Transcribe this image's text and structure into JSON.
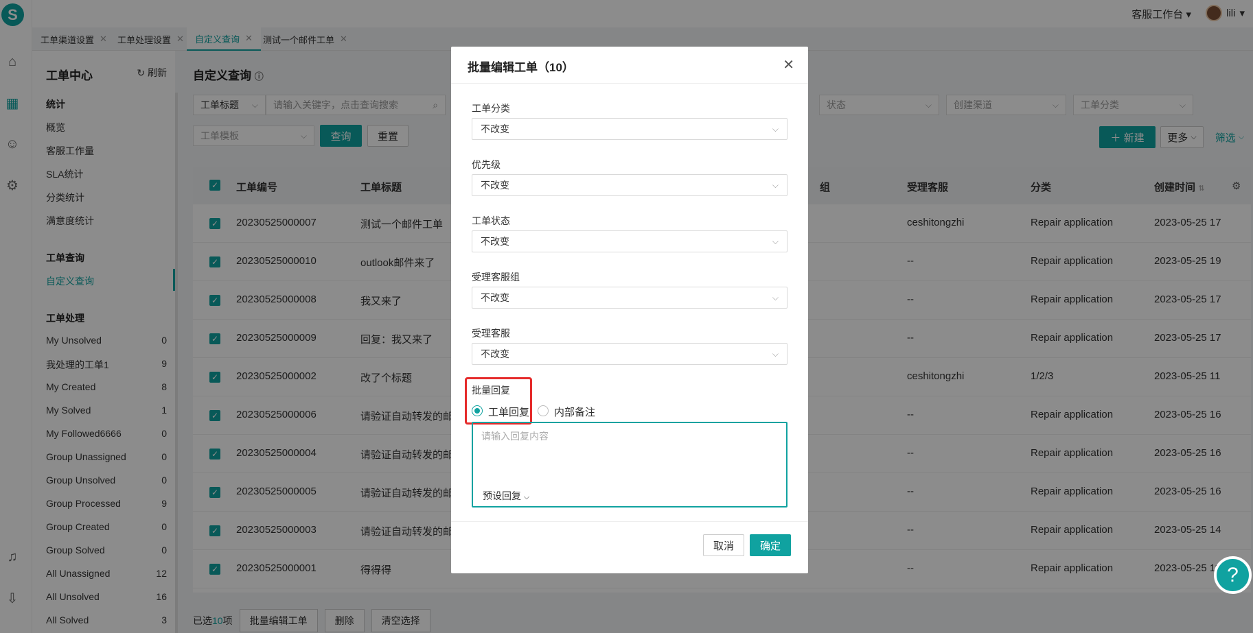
{
  "logo": "S",
  "topbar": {
    "workspace": "客服工作台",
    "username": "lili"
  },
  "tabs": [
    {
      "label": "工单渠道设置"
    },
    {
      "label": "工单处理设置"
    },
    {
      "label": "自定义查询"
    },
    {
      "label": "测试一个邮件工单"
    }
  ],
  "sidebar": {
    "title": "工单中心",
    "refresh": "刷新",
    "stats_header": "统计",
    "stats": [
      "概览",
      "客服工作量",
      "SLA统计",
      "分类统计",
      "满意度统计"
    ],
    "query_header": "工单查询",
    "query_item": "自定义查询",
    "process_header": "工单处理",
    "process": [
      {
        "label": "My Unsolved",
        "count": "0"
      },
      {
        "label": "我处理的工单1",
        "count": "9"
      },
      {
        "label": "My Created",
        "count": "8"
      },
      {
        "label": "My Solved",
        "count": "1"
      },
      {
        "label": "My Followed6666",
        "count": "0"
      },
      {
        "label": "Group Unassigned",
        "count": "0"
      },
      {
        "label": "Group Unsolved",
        "count": "0"
      },
      {
        "label": "Group Processed",
        "count": "9"
      },
      {
        "label": "Group Created",
        "count": "0"
      },
      {
        "label": "Group Solved",
        "count": "0"
      },
      {
        "label": "All Unassigned",
        "count": "12"
      },
      {
        "label": "All Unsolved",
        "count": "16"
      },
      {
        "label": "All Solved",
        "count": "3"
      }
    ]
  },
  "main": {
    "title": "自定义查询",
    "filter_field": "工单标题",
    "search_placeholder": "请输入关键字，点击查询搜索",
    "template": "工单模板",
    "query": "查询",
    "reset": "重置",
    "status": "状态",
    "channel": "创建渠道",
    "category": "工单分类",
    "new": "新建",
    "more": "更多",
    "filter": "筛选"
  },
  "table": {
    "headers": {
      "no": "工单编号",
      "title": "工单标题",
      "group": "组",
      "agent": "受理客服",
      "category": "分类",
      "created": "创建时间"
    },
    "rows": [
      {
        "no": "20230525000007",
        "title": "测试一个邮件工单",
        "agent": "ceshitongzhi",
        "category": "Repair application",
        "created": "2023-05-25 17"
      },
      {
        "no": "20230525000010",
        "title": "outlook邮件来了",
        "agent": "--",
        "category": "Repair application",
        "created": "2023-05-25 19"
      },
      {
        "no": "20230525000008",
        "title": "我又来了",
        "agent": "--",
        "category": "Repair application",
        "created": "2023-05-25 17"
      },
      {
        "no": "20230525000009",
        "title": "回复：我又来了",
        "agent": "--",
        "category": "Repair application",
        "created": "2023-05-25 17"
      },
      {
        "no": "20230525000002",
        "title": "改了个标题",
        "agent": "ceshitongzhi",
        "category": "1/2/3",
        "created": "2023-05-25 11"
      },
      {
        "no": "20230525000006",
        "title": "请验证自动转发的邮箱",
        "agent": "--",
        "category": "Repair application",
        "created": "2023-05-25 16"
      },
      {
        "no": "20230525000004",
        "title": "请验证自动转发的邮箱",
        "agent": "--",
        "category": "Repair application",
        "created": "2023-05-25 16"
      },
      {
        "no": "20230525000005",
        "title": "请验证自动转发的邮箱",
        "agent": "--",
        "category": "Repair application",
        "created": "2023-05-25 16"
      },
      {
        "no": "20230525000003",
        "title": "请验证自动转发的邮箱",
        "agent": "--",
        "category": "Repair application",
        "created": "2023-05-25 14"
      },
      {
        "no": "20230525000001",
        "title": "得得得",
        "agent": "--",
        "category": "Repair application",
        "created": "2023-05-25 11"
      }
    ]
  },
  "footer": {
    "selected_prefix": "已选",
    "selected_count": "10",
    "selected_suffix": "项",
    "bulk_edit": "批量编辑工单",
    "delete": "删除",
    "clear": "清空选择"
  },
  "modal": {
    "title": "批量编辑工单（10）",
    "fields": [
      {
        "label": "工单分类",
        "value": "不改变"
      },
      {
        "label": "优先级",
        "value": "不改变"
      },
      {
        "label": "工单状态",
        "value": "不改变"
      },
      {
        "label": "受理客服组",
        "value": "不改变"
      },
      {
        "label": "受理客服",
        "value": "不改变"
      }
    ],
    "reply_label": "批量回复",
    "reply_option_1": "工单回复",
    "reply_option_2": "内部备注",
    "reply_placeholder": "请输入回复内容",
    "preset": "预设回复",
    "cancel": "取消",
    "confirm": "确定"
  },
  "colors": {
    "accent": "#10a2a0",
    "highlight": "#e52b2b"
  }
}
